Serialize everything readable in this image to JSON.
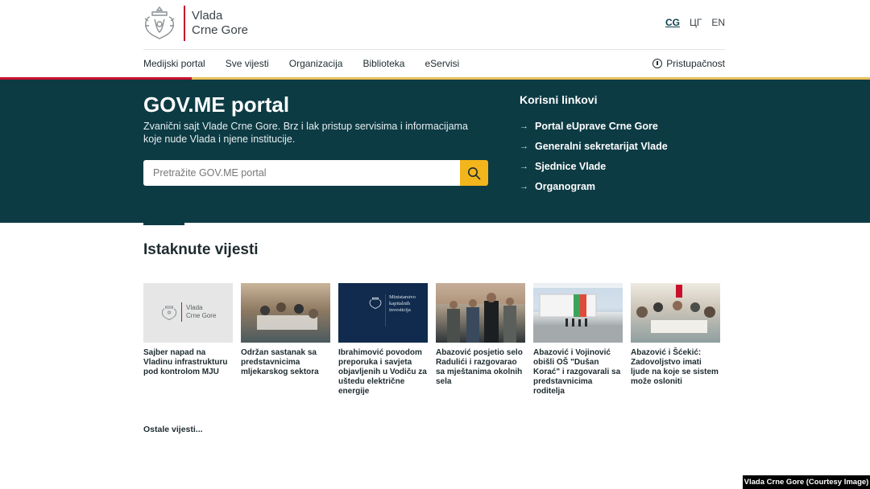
{
  "header": {
    "logo_line1": "Vlada",
    "logo_line2": "Crne Gore",
    "languages": [
      "CG",
      "ЦГ",
      "EN"
    ],
    "active_language": "CG"
  },
  "nav": {
    "items": [
      "Medijski portal",
      "Sve vijesti",
      "Organizacija",
      "Biblioteka",
      "eServisi"
    ],
    "accessibility": "Pristupačnost"
  },
  "hero": {
    "title": "GOV.ME portal",
    "subtitle": "Zvanični sajt Vlade Crne Gore. Brz i lak pristup servisima i informacijama koje nude Vlada i njene institucije.",
    "search_placeholder": "Pretražite GOV.ME portal",
    "links_title": "Korisni linkovi",
    "links": [
      "Portal eUprave Crne Gore",
      "Generalni sekretarijat Vlade",
      "Sjednice Vlade",
      "Organogram"
    ]
  },
  "news": {
    "section_title": "Istaknute vijesti",
    "items": [
      {
        "title": "Sajber napad na Vladinu infrastrukturu pod kontrolom MJU",
        "thumb_text1": "Vlada",
        "thumb_text2": "Crne Gore"
      },
      {
        "title": "Održan sastanak sa predstavnicima mljekarskog sektora"
      },
      {
        "title": "Ibrahimović povodom preporuka i savjeta objavljenih u Vodiču za uštedu električne energije",
        "thumb_text1": "Ministarstvo",
        "thumb_text2": "kapitalnih",
        "thumb_text3": "investicija"
      },
      {
        "title": "Abazović posjetio selo Radulići i razgovarao sa mještanima okolnih sela"
      },
      {
        "title": "Abazović i Vojinović obišli OŠ \"Dušan Korać\" i razgovarali sa predstavnicima roditelja"
      },
      {
        "title": "Abazović i Šćekić: Zadovoljstvo imati ljude na koje se sistem može osloniti"
      }
    ],
    "more_label": "Ostale vijesti..."
  },
  "credit": "Vlada Crne Gore (Courtesy Image)",
  "colors": {
    "brand_dark": "#0d3b44",
    "accent_yellow": "#f2b51c",
    "accent_red": "#c8102e"
  }
}
